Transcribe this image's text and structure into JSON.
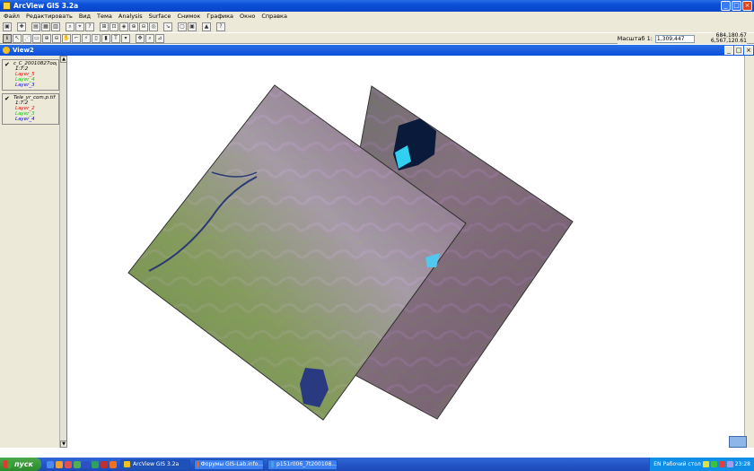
{
  "window": {
    "title": "ArcView GIS 3.2a"
  },
  "menu": [
    "Файл",
    "Редактировать",
    "Вид",
    "Тема",
    "Analysis",
    "Surface",
    "Снимок",
    "Графика",
    "Окно",
    "Справка"
  ],
  "toolbar": {
    "scale_label": "Масштаб 1:",
    "scale_value": "1,309,447",
    "coord_x": "684,180.67",
    "coord_y": "6,567,120.61"
  },
  "view": {
    "title": "View2"
  },
  "toc": {
    "themes": [
      {
        "name": "c_C_20010827oорр",
        "sub": "1:7:2",
        "layers": [
          {
            "label": "Layer_5",
            "color": "#ff0000"
          },
          {
            "label": "Layer_4",
            "color": "#00cc00"
          },
          {
            "label": "Layer_3",
            "color": "#0000ff"
          }
        ]
      },
      {
        "name": "Tele_yr_com.p.tif",
        "sub": "1:7:2",
        "layers": [
          {
            "label": "Layer_2",
            "color": "#ff0000"
          },
          {
            "label": "Layer_3",
            "color": "#00cc00"
          },
          {
            "label": "Layer_4",
            "color": "#0000ff"
          }
        ]
      }
    ]
  },
  "taskbar": {
    "start": "пуск",
    "tasks": [
      "ArcView GIS 3.2a",
      "Форумы GIS-Lab.info...",
      "p151r006_7t200108..."
    ],
    "lang": "EN",
    "tray_text": "Рабочий стол",
    "clock": "23:28"
  }
}
